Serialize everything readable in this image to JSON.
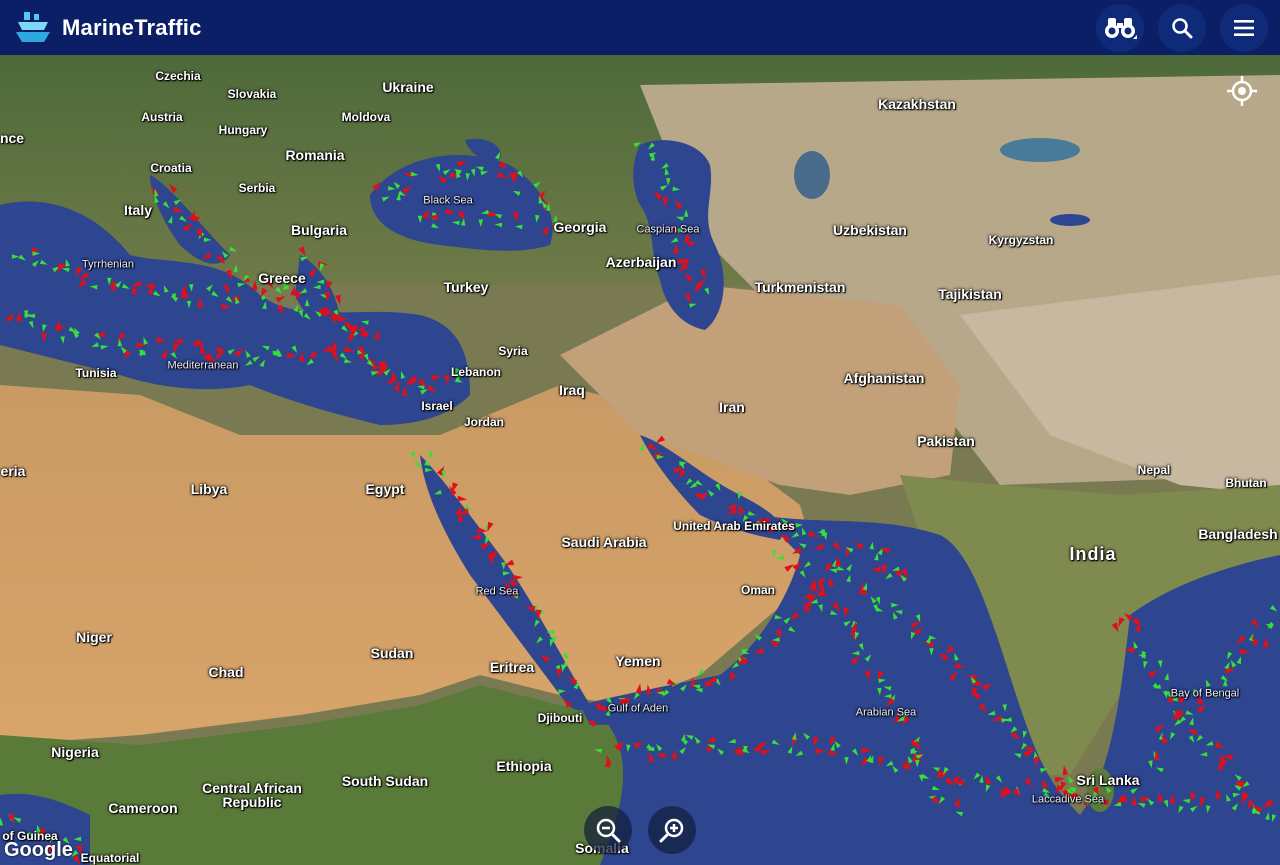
{
  "header": {
    "app_name": "MarineTraffic",
    "logo_icon": "ship-logo-icon",
    "actions": [
      {
        "icon": "binoculars-icon",
        "name": "binoculars-button"
      },
      {
        "icon": "search-icon",
        "name": "search-button"
      },
      {
        "icon": "hamburger-menu-icon",
        "name": "menu-button"
      }
    ]
  },
  "colors": {
    "header_bg": "#0a1f66",
    "vessel_cargo": "#35e03a",
    "vessel_tanker": "#e0101a",
    "sea": "#2c3f8c",
    "land_desert": "#d49a63",
    "land_green": "#5f7a3f"
  },
  "map_labels": {
    "czechia": "Czechia",
    "slovakia": "Slovakia",
    "ukraine": "Ukraine",
    "kazakhstan": "Kazakhstan",
    "austria": "Austria",
    "hungary": "Hungary",
    "moldova": "Moldova",
    "france_partial": "nce",
    "romania": "Romania",
    "croatia": "Croatia",
    "serbia": "Serbia",
    "italy": "Italy",
    "bulgaria": "Bulgaria",
    "black_sea": "Black Sea",
    "georgia": "Georgia",
    "caspian_sea": "Caspian Sea",
    "uzbekistan": "Uzbekistan",
    "kyrgyzstan": "Kyrgyzstan",
    "tyrrhenian": "Tyrrhenian",
    "greece": "Greece",
    "azerbaijan": "Azerbaijan",
    "turkey": "Turkey",
    "turkmenistan": "Turkmenistan",
    "tajikistan": "Tajikistan",
    "tunisia": "Tunisia",
    "mediterranean": "Mediterranean",
    "syria": "Syria",
    "lebanon": "Lebanon",
    "iraq": "Iraq",
    "afghanistan": "Afghanistan",
    "iran": "Iran",
    "israel": "Israel",
    "jordan": "Jordan",
    "pakistan": "Pakistan",
    "algeria_partial": "eria",
    "libya": "Libya",
    "egypt": "Egypt",
    "nepal": "Nepal",
    "bhutan": "Bhutan",
    "uae": "United Arab Emirates",
    "saudi_arabia": "Saudi Arabia",
    "bangladesh": "Bangladesh",
    "india": "India",
    "oman": "Oman",
    "red_sea": "Red Sea",
    "niger": "Niger",
    "sudan": "Sudan",
    "yemen": "Yemen",
    "chad": "Chad",
    "eritrea": "Eritrea",
    "bay_of_bengal": "Bay of Bengal",
    "djibouti": "Djibouti",
    "gulf_of_aden": "Gulf of Aden",
    "arabian_sea": "Arabian Sea",
    "nigeria": "Nigeria",
    "ethiopia": "Ethiopia",
    "car": "Central African Republic",
    "south_sudan": "South Sudan",
    "sri_lanka": "Sri Lanka",
    "cameroon": "Cameroon",
    "laccadive_sea": "Laccadive Sea",
    "gulf_of_guinea": "of Guinea",
    "equatorial": "Equatorial",
    "somalia": "Somalia"
  },
  "controls": {
    "locate_icon": "crosshair-locate-icon",
    "zoom_out_icon": "zoom-out-icon",
    "zoom_in_icon": "zoom-in-icon",
    "attribution": "Google"
  }
}
